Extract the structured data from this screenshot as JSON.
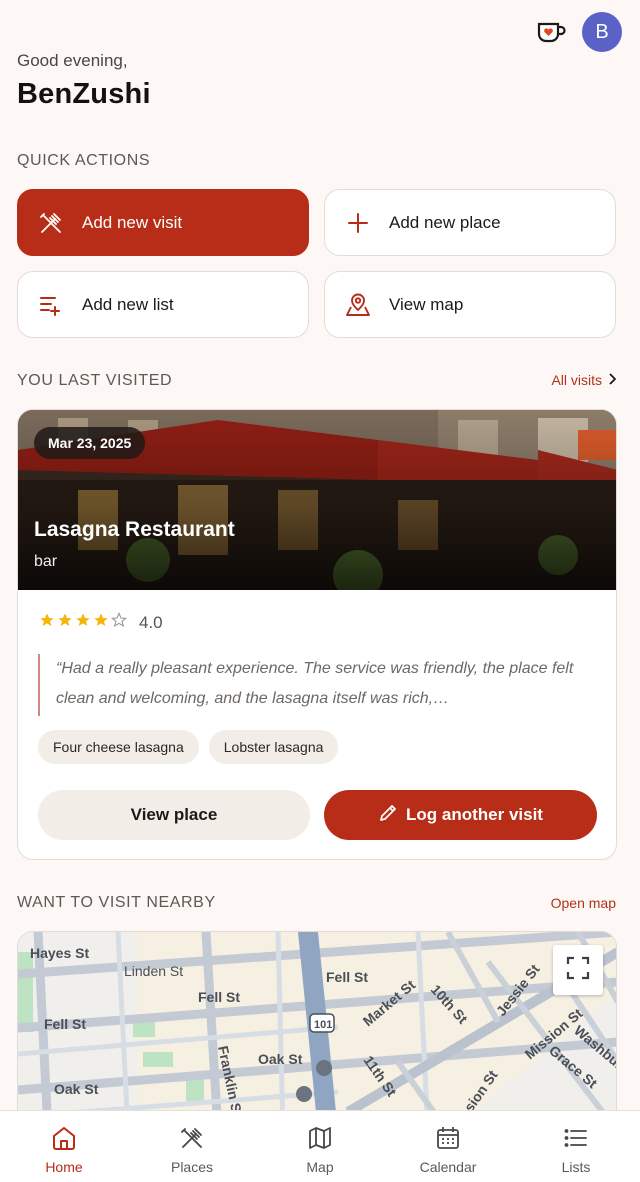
{
  "header": {
    "greeting": "Good evening,",
    "username": "BenZushi",
    "avatar_initial": "B",
    "coffee_icon": "coffee-heart-icon"
  },
  "quick_actions": {
    "title": "QUICK ACTIONS",
    "items": [
      {
        "label": "Add new visit",
        "icon": "fork-knife-icon",
        "primary": true
      },
      {
        "label": "Add new place",
        "icon": "plus-icon",
        "primary": false
      },
      {
        "label": "Add new list",
        "icon": "list-add-icon",
        "primary": false
      },
      {
        "label": "View map",
        "icon": "map-pin-icon",
        "primary": false
      }
    ]
  },
  "last_visited": {
    "title": "YOU LAST VISITED",
    "all_link": "All visits",
    "date": "Mar 23, 2025",
    "place_name": "Lasagna Restaurant",
    "place_type": "bar",
    "rating_value": "4.0",
    "stars": 4,
    "quote": "“Had a really pleasant experience. The service was friendly, the place felt clean and welcoming, and the lasagna itself was rich,…",
    "tags": [
      "Four cheese lasagna",
      "Lobster lasagna"
    ],
    "view_button": "View place",
    "log_button": "Log another visit"
  },
  "nearby": {
    "title": "WANT TO VISIT NEARBY",
    "open_map": "Open map",
    "streets": [
      "Hayes St",
      "Linden St",
      "Fell St",
      "Fell St",
      "Fell St",
      "Oak St",
      "Oak St",
      "Franklin St",
      "Market St",
      "10th St",
      "Jessie St",
      "Mission St",
      "Washburn",
      "Grace St",
      "11th St",
      "Mission St",
      "101"
    ]
  },
  "nav": {
    "items": [
      {
        "label": "Home",
        "icon": "home-icon",
        "active": true
      },
      {
        "label": "Places",
        "icon": "fork-knife-icon",
        "active": false
      },
      {
        "label": "Map",
        "icon": "map-icon",
        "active": false
      },
      {
        "label": "Calendar",
        "icon": "calendar-icon",
        "active": false
      },
      {
        "label": "Lists",
        "icon": "list-icon",
        "active": false
      }
    ]
  },
  "colors": {
    "accent": "#b72d17",
    "background": "#fdf8f5",
    "avatar": "#5a62c8",
    "star": "#f5b50a"
  }
}
